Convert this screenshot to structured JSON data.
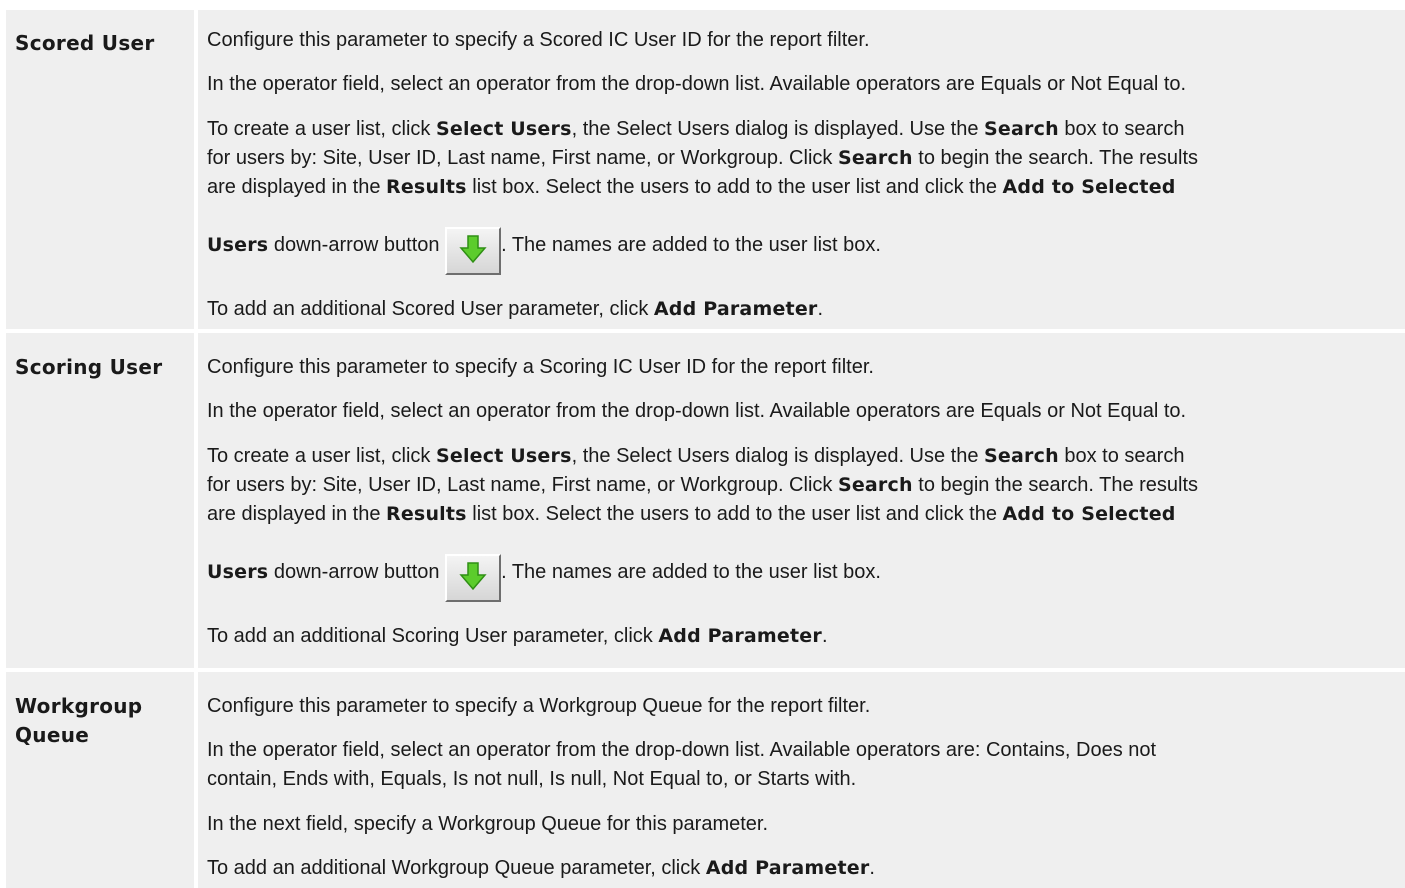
{
  "rows": [
    {
      "label": "Scored User",
      "p1": "Configure this parameter to specify a Scored IC User ID for the report filter.",
      "p2": "In the operator field, select an operator from the drop-down list. Available operators are Equals or Not Equal to.",
      "p3": {
        "l1a": "To create a user list, click ",
        "l1b": "Select Users",
        "l1c": ", the Select Users dialog is displayed. Use the ",
        "l1d": "Search",
        "l1e": " box to search",
        "l2a": "for users by: Site, User ID, Last name, First name, or Workgroup. Click ",
        "l2b": "Search",
        "l2c": " to begin the search. The results",
        "l3a": "are displayed in the ",
        "l3b": "Results",
        "l3c": " list box. Select the users to add to the user list and click the ",
        "l3d": "Add to Selected",
        "l4a": "Users",
        "l4b": " down-arrow button ",
        "l4c": ". The names are added to the user list box."
      },
      "p4a": "To add an additional Scored User parameter, click ",
      "p4b": "Add Parameter",
      "p4c": "."
    },
    {
      "label": "Scoring User",
      "p1": "Configure this parameter to specify a Scoring IC User ID for the report filter.",
      "p2": "In the operator field, select an operator from the drop-down list. Available operators are Equals or Not Equal to.",
      "p3": {
        "l1a": "To create a user list, click ",
        "l1b": "Select Users",
        "l1c": ", the Select Users dialog is displayed. Use the ",
        "l1d": "Search",
        "l1e": " box to search",
        "l2a": "for users by: Site, User ID, Last name, First name, or Workgroup. Click ",
        "l2b": "Search",
        "l2c": " to begin the search. The results",
        "l3a": "are displayed in the ",
        "l3b": "Results",
        "l3c": " list box. Select the users to add to the user list and click the ",
        "l3d": "Add to Selected",
        "l4a": "Users",
        "l4b": " down-arrow button ",
        "l4c": ". The names are added to the user list box."
      },
      "p4a": "To add an additional Scoring User parameter, click ",
      "p4b": "Add Parameter",
      "p4c": "."
    },
    {
      "label": "Workgroup Queue",
      "p1": "Configure this parameter to specify a Workgroup Queue for the report filter.",
      "p2a": "In the operator field, select an operator from the drop-down list. Available operators are: Contains, Does not",
      "p2b": "contain, Ends with, Equals, Is not null, Is null, Not Equal to, or Starts with.",
      "p3": "In the next field, specify a Workgroup Queue for this parameter.",
      "p4a": "To add an additional Workgroup Queue parameter, click ",
      "p4b": "Add Parameter",
      "p4c": "."
    }
  ],
  "icons": {
    "arrow_button": "green-down-arrow-icon"
  },
  "colors": {
    "cell_bg": "#efefef",
    "text": "#1a1a1a",
    "arrow_green": "#5ccc2c"
  }
}
